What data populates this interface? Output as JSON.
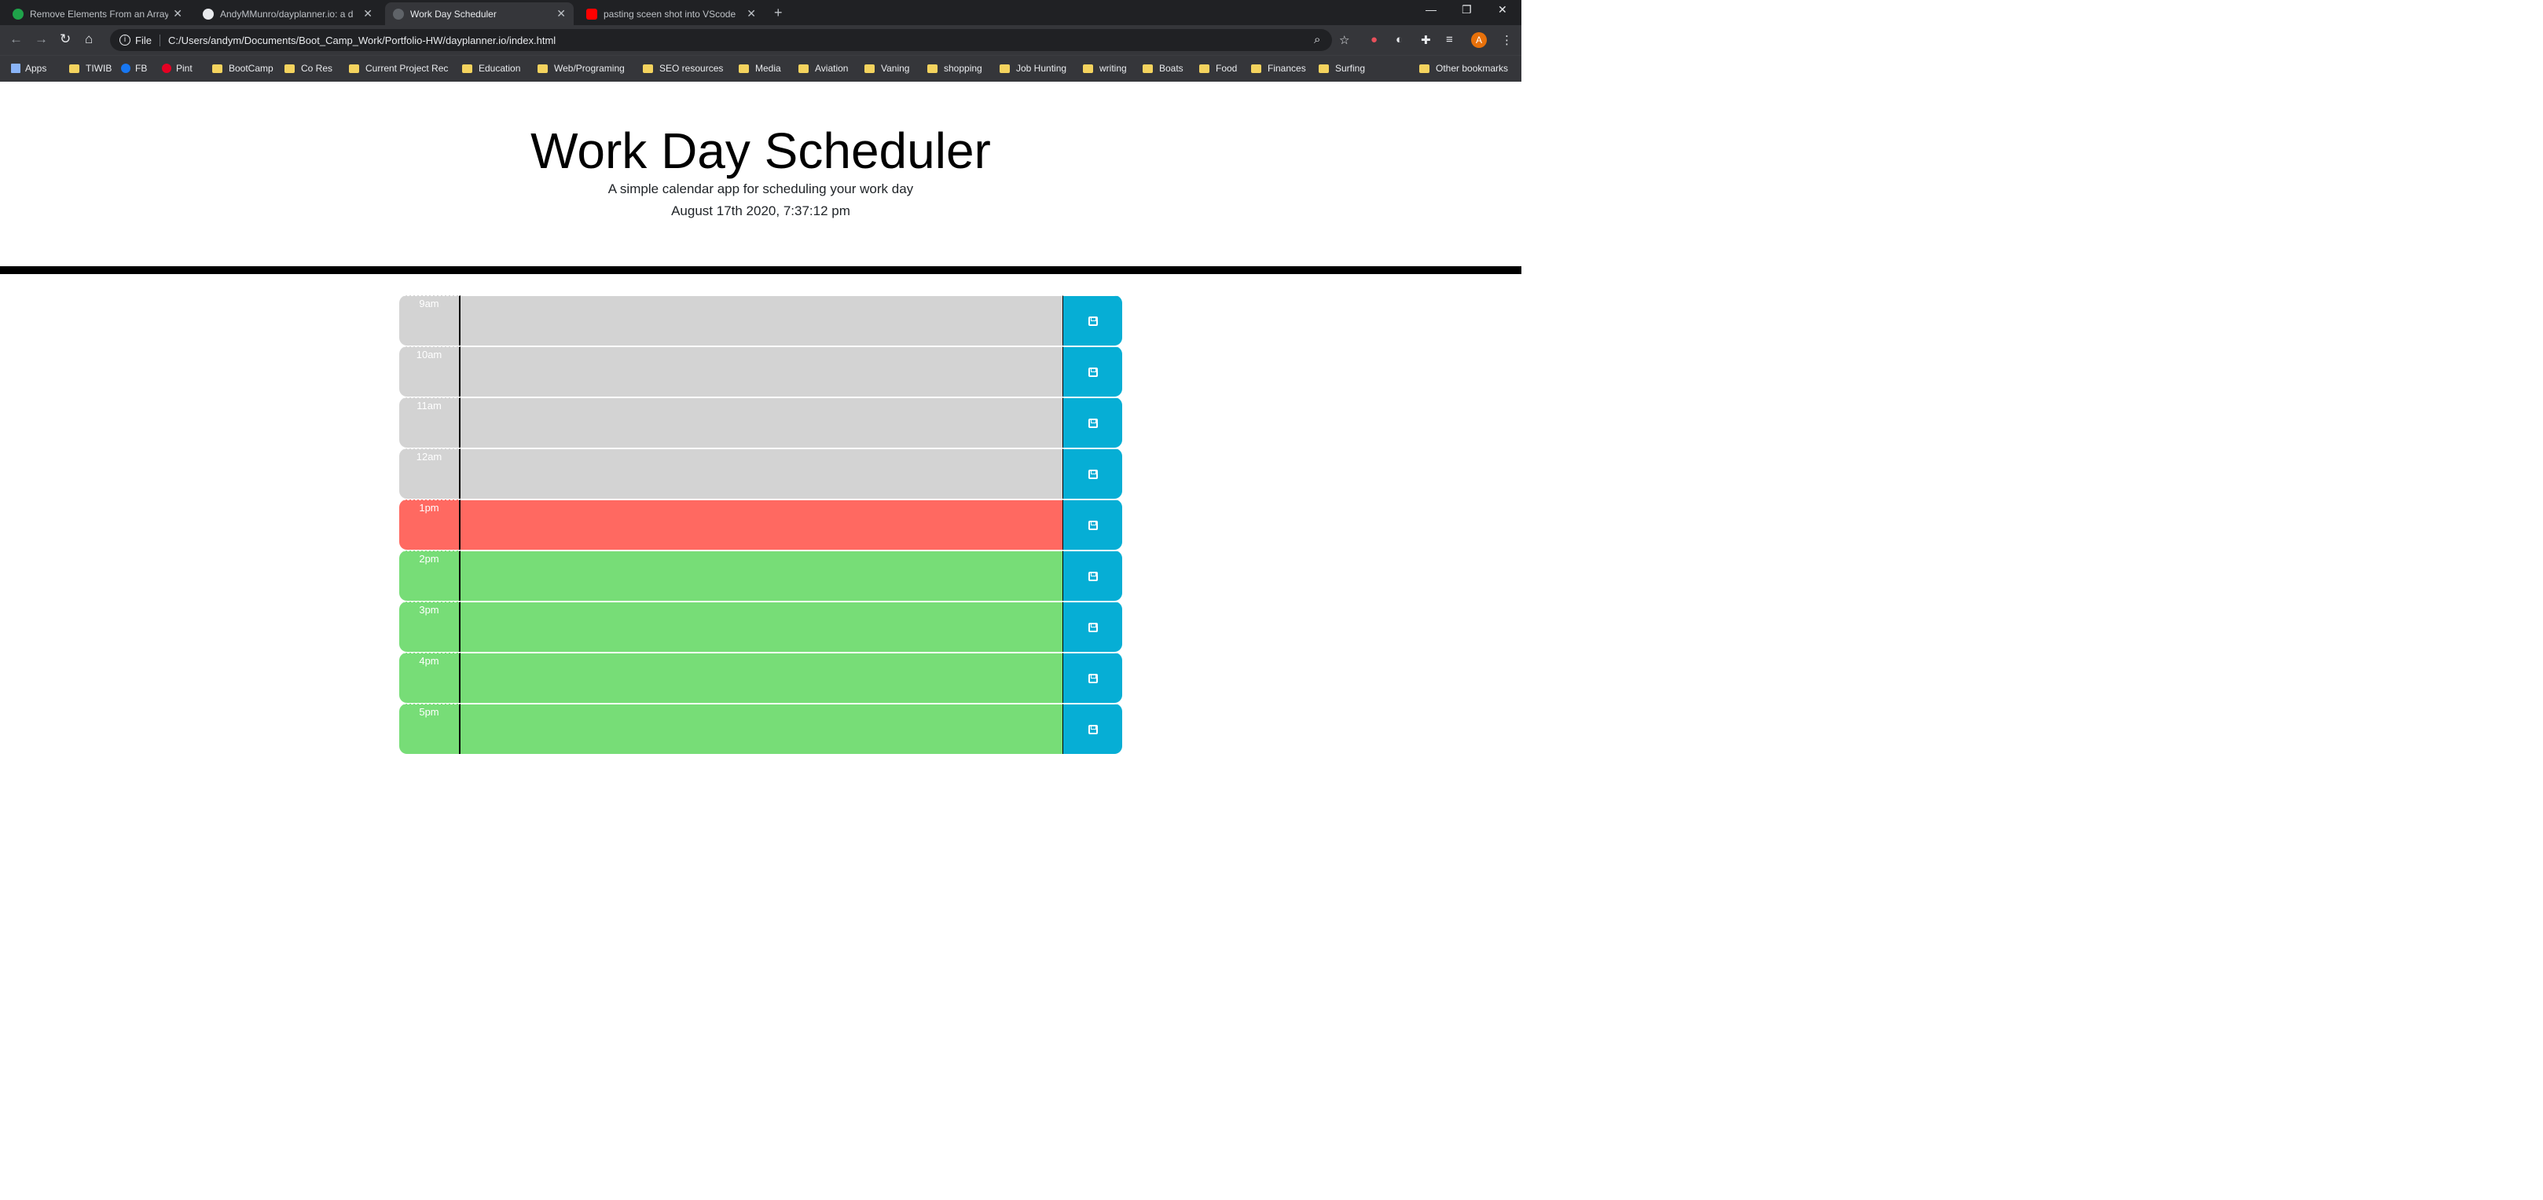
{
  "colors": {
    "past": "#d3d3d3",
    "present": "#ff6961",
    "future": "#77dd77",
    "save": "#06aed5"
  },
  "browser": {
    "tabs": [
      {
        "title": "Remove Elements From an Array",
        "icon": "freecodecamp-icon",
        "active": false
      },
      {
        "title": "AndyMMunro/dayplanner.io: a d",
        "icon": "github-icon",
        "active": false
      },
      {
        "title": "Work Day Scheduler",
        "icon": "globe-icon",
        "active": true
      },
      {
        "title": "pasting sceen shot into VScode",
        "icon": "youtube-icon",
        "active": false
      }
    ],
    "omnibox": {
      "scheme_label": "File",
      "url": "C:/Users/andym/Documents/Boot_Camp_Work/Portfolio-HW/dayplanner.io/index.html"
    },
    "profile_initial": "A",
    "bookmarks": [
      {
        "label": "Apps",
        "kind": "apps"
      },
      {
        "label": "TIWIB",
        "kind": "folder"
      },
      {
        "label": "FB",
        "kind": "facebook"
      },
      {
        "label": "Pint",
        "kind": "pinterest"
      },
      {
        "label": "BootCamp",
        "kind": "folder"
      },
      {
        "label": "Co Res",
        "kind": "folder"
      },
      {
        "label": "Current Project Rec",
        "kind": "folder"
      },
      {
        "label": "Education",
        "kind": "folder"
      },
      {
        "label": "Web/Programing",
        "kind": "folder"
      },
      {
        "label": "SEO resources",
        "kind": "folder"
      },
      {
        "label": "Media",
        "kind": "folder"
      },
      {
        "label": "Aviation",
        "kind": "folder"
      },
      {
        "label": "Vaning",
        "kind": "folder"
      },
      {
        "label": "shopping",
        "kind": "folder"
      },
      {
        "label": "Job Hunting",
        "kind": "folder"
      },
      {
        "label": "writing",
        "kind": "folder"
      },
      {
        "label": "Boats",
        "kind": "folder"
      },
      {
        "label": "Food",
        "kind": "folder"
      },
      {
        "label": "Finances",
        "kind": "folder"
      },
      {
        "label": "Surfing",
        "kind": "folder"
      }
    ],
    "other_bookmarks": "Other bookmarks"
  },
  "page": {
    "title": "Work Day Scheduler",
    "lead": "A simple calendar app for scheduling your work day",
    "current_day": "August 17th 2020, 7:37:12 pm"
  },
  "planner": {
    "rows": [
      {
        "hour": "9am",
        "state": "past",
        "text": ""
      },
      {
        "hour": "10am",
        "state": "past",
        "text": ""
      },
      {
        "hour": "11am",
        "state": "past",
        "text": ""
      },
      {
        "hour": "12am",
        "state": "past",
        "text": ""
      },
      {
        "hour": "1pm",
        "state": "present",
        "text": ""
      },
      {
        "hour": "2pm",
        "state": "future",
        "text": ""
      },
      {
        "hour": "3pm",
        "state": "future",
        "text": ""
      },
      {
        "hour": "4pm",
        "state": "future",
        "text": ""
      },
      {
        "hour": "5pm",
        "state": "future",
        "text": ""
      }
    ],
    "save_icon": "floppy-disk-icon"
  }
}
